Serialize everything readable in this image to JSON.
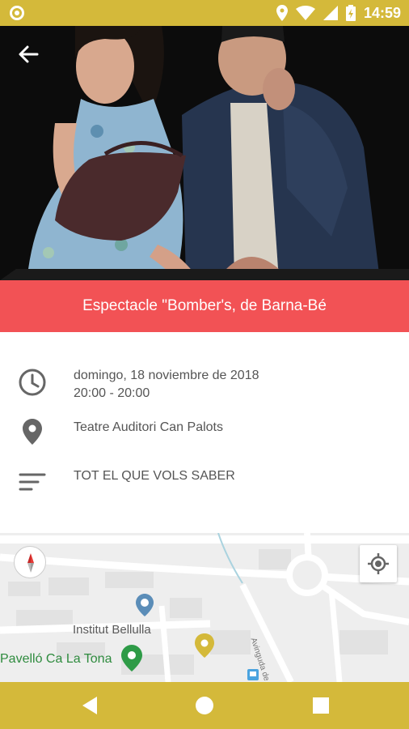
{
  "status_bar": {
    "time": "14:59",
    "icons": [
      "notification-icon",
      "location-icon",
      "wifi-icon",
      "signal-icon",
      "battery-icon"
    ]
  },
  "hero": {
    "image": "event-photo"
  },
  "event": {
    "title": "Espectacle \"Bomber's, de Barna-Bé",
    "date": "domingo, 18 noviembre de 2018",
    "time": "20:00 - 20:00",
    "venue": "Teatre Auditori Can Palots",
    "description": "TOT EL QUE VOLS SABER"
  },
  "map": {
    "labels": {
      "institut": "Institut Bellulla",
      "pavello": "Pavelló Ca La Tona",
      "street": "Avinguda de Calldetenes"
    }
  },
  "colors": {
    "accent": "#d4b93a",
    "title_band": "#f25255",
    "hero_background": "#0c0c0c"
  }
}
